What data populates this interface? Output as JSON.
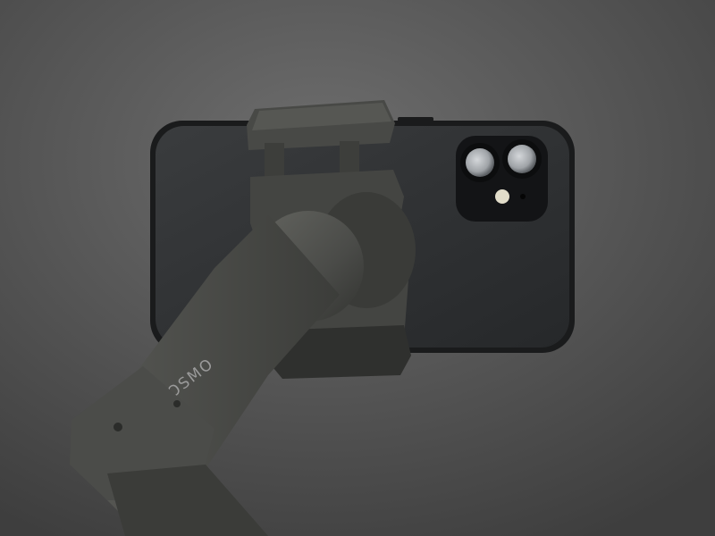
{
  "photo": {
    "subject": "phone-gimbal-with-smartphone",
    "brand_text": "OSMO",
    "colors": {
      "background_light": "#6e6e6e",
      "background_dark": "#3e3e3e",
      "gimbal_body": "#4a4b48",
      "gimbal_highlight": "#61625e",
      "gimbal_shadow": "#2f302e",
      "phone_back": "#2e3032",
      "phone_frame": "#1a1b1c",
      "camera_module": "#131416",
      "lens_glass": "#b9bcbf"
    }
  }
}
